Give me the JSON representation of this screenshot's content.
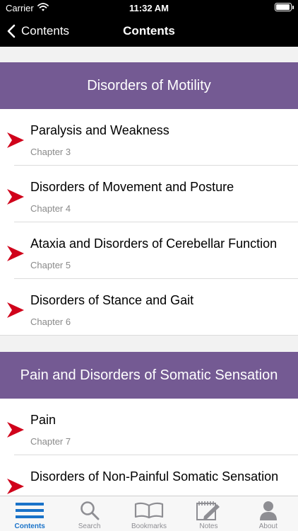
{
  "status_bar": {
    "carrier": "Carrier",
    "time": "11:32 AM",
    "battery_level": 0.95
  },
  "nav": {
    "back_label": "Contents",
    "title": "Contents"
  },
  "sections": [
    {
      "title": "Disorders of Motility",
      "items": [
        {
          "title": "Paralysis and Weakness",
          "subtitle": "Chapter 3"
        },
        {
          "title": "Disorders of Movement and Posture",
          "subtitle": "Chapter 4"
        },
        {
          "title": "Ataxia and Disorders of Cerebellar Function",
          "subtitle": "Chapter 5"
        },
        {
          "title": "Disorders of Stance and Gait",
          "subtitle": "Chapter 6"
        }
      ]
    },
    {
      "title": "Pain and Disorders of Somatic Sensation",
      "items": [
        {
          "title": "Pain",
          "subtitle": "Chapter 7"
        },
        {
          "title": "Disorders of Non-Painful Somatic Sensation",
          "subtitle": ""
        }
      ]
    }
  ],
  "tabs": [
    {
      "label": "Contents",
      "icon": "list-icon",
      "active": true
    },
    {
      "label": "Search",
      "icon": "search-icon",
      "active": false
    },
    {
      "label": "Bookmarks",
      "icon": "book-icon",
      "active": false
    },
    {
      "label": "Notes",
      "icon": "notes-icon",
      "active": false
    },
    {
      "label": "About",
      "icon": "person-icon",
      "active": false
    }
  ],
  "colors": {
    "section_header": "#745a93",
    "arrow": "#d0021b",
    "tab_active": "#1a73c9",
    "tab_inactive": "#8e8e93"
  }
}
